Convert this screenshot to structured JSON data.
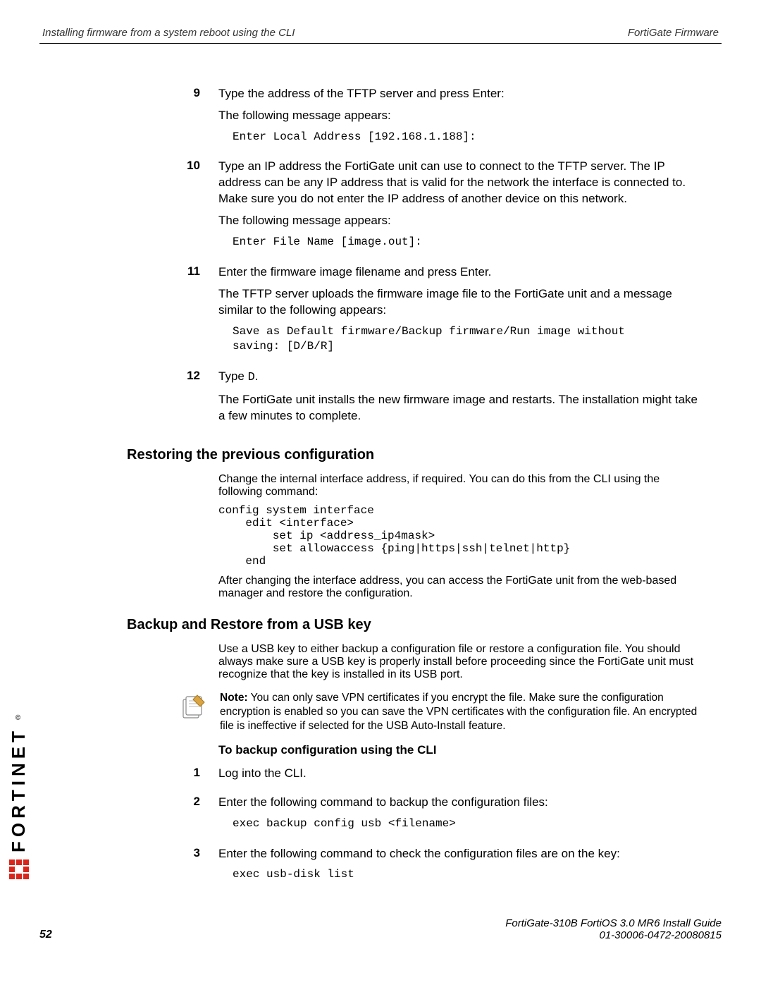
{
  "header": {
    "left": "Installing firmware from a system reboot using the CLI",
    "right": "FortiGate Firmware"
  },
  "steps": {
    "s9": {
      "num": "9",
      "p1": "Type the address of the TFTP server and press Enter:",
      "p2": "The following message appears:",
      "code": "Enter Local Address [192.168.1.188]:"
    },
    "s10": {
      "num": "10",
      "p1": "Type an IP address the FortiGate unit can use to connect to the TFTP server. The IP address can be any IP address that is valid for the network the interface is connected to. Make sure you do not enter the IP address of another device on this network.",
      "p2": "The following message appears:",
      "code": "Enter File Name [image.out]:"
    },
    "s11": {
      "num": "11",
      "p1": "Enter the firmware image filename and press Enter.",
      "p2": "The TFTP server uploads the firmware image file to the FortiGate unit and a message similar to the following appears:",
      "code": "Save as Default firmware/Backup firmware/Run image without\nsaving: [D/B/R]"
    },
    "s12": {
      "num": "12",
      "p1a": "Type ",
      "p1b": "D",
      "p1c": ".",
      "p2": "The FortiGate unit installs the new firmware image and restarts. The installation might take a few minutes to complete."
    }
  },
  "restoring": {
    "heading": "Restoring the previous configuration",
    "p1": "Change the internal interface address, if required. You can do this from the CLI using the following command:",
    "code": "config system interface\n    edit <interface>\n        set ip <address_ip4mask>\n        set allowaccess {ping|https|ssh|telnet|http}\n    end",
    "p2": "After changing the interface address, you can access the FortiGate unit from the web-based manager and restore the configuration."
  },
  "usb": {
    "heading": "Backup and Restore from a USB key",
    "p1": "Use a USB key to either backup a configuration file or restore a configuration file. You should always make sure a USB key is properly install before proceeding since the FortiGate unit must recognize that the key is installed in its USB port.",
    "note_label": "Note:",
    "note_text": " You can only save VPN certificates if you encrypt the file. Make sure the configuration encryption is enabled so you can save the VPN certificates with the configuration file. An encrypted file is ineffective if selected for the USB Auto-Install feature.",
    "subheading": "To backup configuration using the CLI",
    "s1": {
      "num": "1",
      "p": "Log into the CLI."
    },
    "s2": {
      "num": "2",
      "p": "Enter the following command to backup the configuration files:",
      "code": "exec backup config usb <filename>"
    },
    "s3": {
      "num": "3",
      "p": "Enter the following command to check the configuration files are on the key:",
      "code": "exec usb-disk list"
    }
  },
  "footer": {
    "line1": "FortiGate-310B FortiOS 3.0 MR6 Install Guide",
    "line2": "01-30006-0472-20080815",
    "page": "52"
  },
  "logo": {
    "text": "FORTINET"
  }
}
